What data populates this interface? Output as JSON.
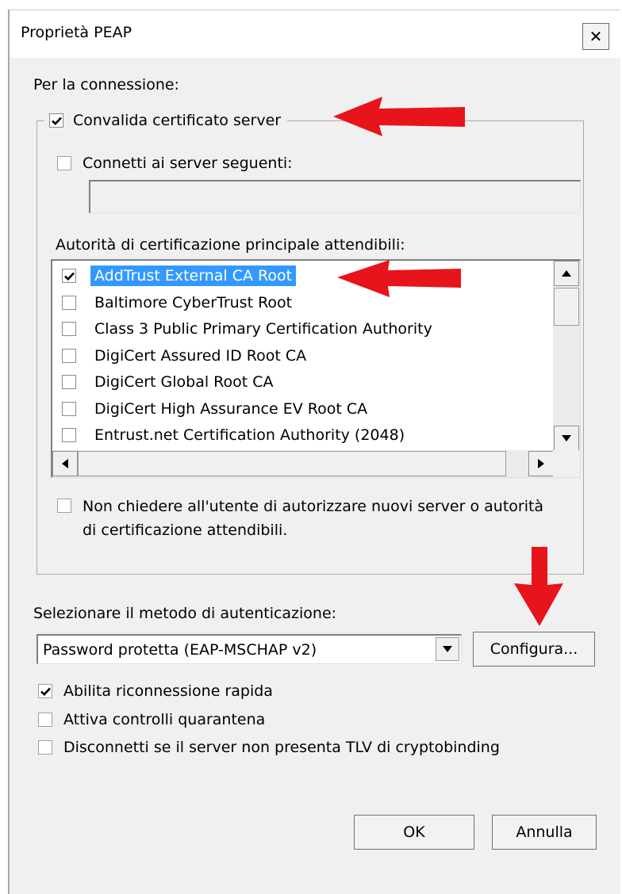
{
  "window": {
    "title": "Proprietà PEAP",
    "close_symbol": "✕"
  },
  "connection_label": "Per la connessione:",
  "validate": {
    "label": "Convalida certificato server",
    "checked": true
  },
  "connect_servers": {
    "label": "Connetti ai server seguenti:",
    "checked": false,
    "value": ""
  },
  "trusted_ca": {
    "label": "Autorità di certificazione principale attendibili:",
    "items": [
      {
        "label": "AddTrust External CA Root",
        "checked": true,
        "selected": true
      },
      {
        "label": "Baltimore CyberTrust Root",
        "checked": false,
        "selected": false
      },
      {
        "label": "Class 3 Public Primary Certification Authority",
        "checked": false,
        "selected": false
      },
      {
        "label": "DigiCert Assured ID Root CA",
        "checked": false,
        "selected": false
      },
      {
        "label": "DigiCert Global Root CA",
        "checked": false,
        "selected": false
      },
      {
        "label": "DigiCert High Assurance EV Root CA",
        "checked": false,
        "selected": false
      },
      {
        "label": "Entrust.net Certification Authority (2048)",
        "checked": false,
        "selected": false
      }
    ]
  },
  "no_prompt": {
    "line1": "Non chiedere all'utente di autorizzare nuovi server o autorità",
    "line2": "di certificazione attendibili.",
    "checked": false
  },
  "auth_method": {
    "label": "Selezionare il metodo di autenticazione:",
    "selected": "Password protetta (EAP-MSCHAP v2)",
    "configure_label": "Configura..."
  },
  "options": [
    {
      "label": "Abilita riconnessione rapida",
      "checked": true
    },
    {
      "label": "Attiva controlli quarantena",
      "checked": false
    },
    {
      "label": "Disconnetti se il server non presenta TLV di cryptobinding",
      "checked": false
    }
  ],
  "buttons": {
    "ok": "OK",
    "cancel": "Annulla"
  },
  "colors": {
    "arrow": "#e8141b",
    "selection": "#3399ff"
  }
}
